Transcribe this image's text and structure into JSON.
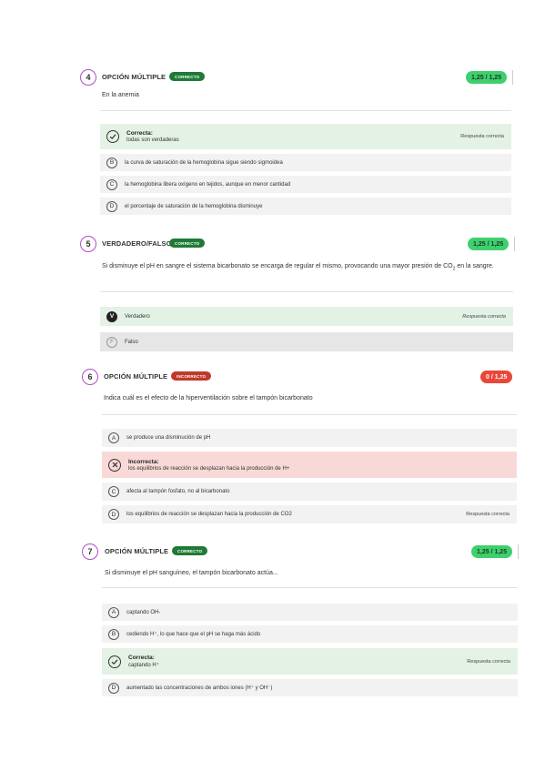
{
  "colors": {
    "accent_ring": "#b04ec8",
    "correct_badge": "#1f7a35",
    "wrong_badge": "#c0392b",
    "score_ok": "#3fd06e",
    "score_bad": "#e8473a",
    "option_correct_bg": "#e4f2e6",
    "option_wrong_bg": "#f9d9d7",
    "option_bg": "#f2f2f2"
  },
  "questions": [
    {
      "number": "4",
      "type": "OPCIÓN MÚLTIPLE",
      "status": "CORRECTO",
      "score": "1,25 / 1,25",
      "text": "En la anemia",
      "options": [
        {
          "letter": "",
          "icon": "check-circle-icon",
          "head": "Correcta:",
          "label": "todas son verdaderas",
          "note": "Respuesta correcta"
        },
        {
          "letter": "B",
          "label": "la curva de saturación de la hemoglobina sigue siendo sigmoidea"
        },
        {
          "letter": "C",
          "label": "la hemoglobina libera oxígeno en tejidos, aunque en menor cantidad"
        },
        {
          "letter": "D",
          "label": "el porcentaje de saturación de la hemoglobina disminuye"
        }
      ]
    },
    {
      "number": "5",
      "type": "VERDADERO/FALSO",
      "status": "CORRECTO",
      "score": "1,25 / 1,25",
      "text_a": "Si disminuye el pH en sangre el sistema bicarbonato se encarga de regular el mismo, provocando una mayor presión de CO",
      "text_sub": "2",
      "text_b": " en la sangre.",
      "options": [
        {
          "letter": "V",
          "label": "Verdadero",
          "note": "Respuesta correcta"
        },
        {
          "letter": "F",
          "label": "Falso"
        }
      ]
    },
    {
      "number": "6",
      "type": "OPCIÓN MÚLTIPLE",
      "status": "INCORRECTO",
      "score": "0 / 1,25",
      "text": "Indica cuál es el efecto de la hiperventilación sobre el tampón bicarbonato",
      "options": [
        {
          "letter": "A",
          "label": "se produce una disminución de pH"
        },
        {
          "letter": "",
          "icon": "x-circle-icon",
          "head": "Incorrecta:",
          "label": "los equilibrios de reacción se desplazan hacia la producción de H+"
        },
        {
          "letter": "C",
          "label": "afecta al tampón fosfato, no al bicarbonato"
        },
        {
          "letter": "D",
          "label": "los equilibrios de reacción se desplazan hacia la producción de CO2",
          "note": "Respuesta correcta"
        }
      ]
    },
    {
      "number": "7",
      "type": "OPCIÓN MÚLTIPLE",
      "status": "CORRECTO",
      "score": "1,25 / 1,25",
      "text": "Si disminuye el pH sanguíneo, el tampón bicarbonato actúa...",
      "options": [
        {
          "letter": "A",
          "label": "captando OH-"
        },
        {
          "letter": "B",
          "label": "cediendo H⁺, lo que hace que el pH se haga más ácido"
        },
        {
          "letter": "",
          "icon": "check-circle-icon",
          "head": "Correcta:",
          "label": "captando H⁺",
          "note": "Respuesta correcta"
        },
        {
          "letter": "D",
          "label": "aumentado las concentraciones de ambos iones (H⁺ y OH⁻)"
        }
      ]
    }
  ]
}
